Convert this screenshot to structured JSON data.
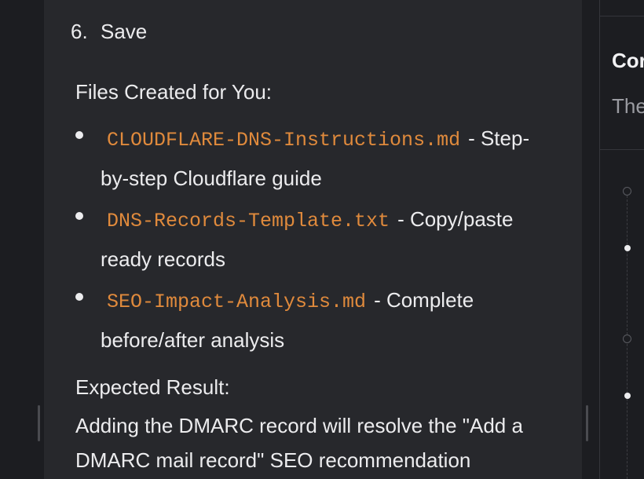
{
  "main": {
    "step": {
      "number": "6.",
      "label": "Save"
    },
    "files_heading": "Files Created for You:",
    "files": [
      {
        "name": "CLOUDFLARE-DNS-Instructions.md",
        "desc": "- Step-by-step Cloudflare guide"
      },
      {
        "name": "DNS-Records-Template.txt",
        "desc": "- Copy/paste ready records"
      },
      {
        "name": "SEO-Impact-Analysis.md",
        "desc": "- Complete before/after analysis"
      }
    ],
    "expected_heading": "Expected Result:",
    "expected_body": "Adding the DMARC record will resolve the \"Add a DMARC mail record\" SEO recommendation"
  },
  "right_panel": {
    "title": "Cor",
    "subtitle": "The"
  },
  "colors": {
    "code": "#e08a3c",
    "text": "#ececee",
    "panel_bg": "#27282c",
    "page_bg": "#1c1d21"
  }
}
